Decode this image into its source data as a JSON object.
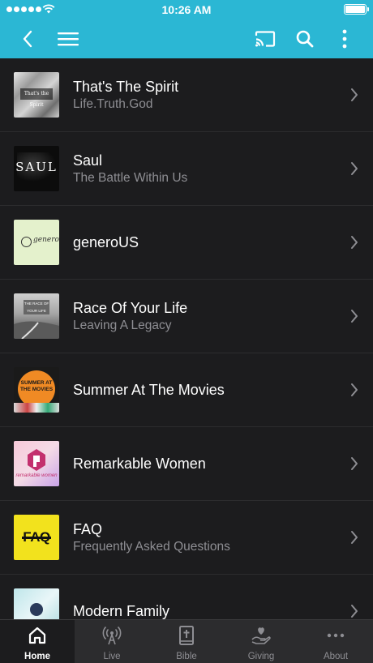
{
  "status_bar": {
    "time": "10:26 AM",
    "signal_icon": "signal-dots-icon",
    "wifi_icon": "wifi-icon",
    "battery_icon": "battery-icon"
  },
  "nav_bar": {
    "background": "#2bb7d4",
    "back_icon": "chevron-left-icon",
    "menu_icon": "hamburger-menu-icon",
    "cast_icon": "cast-icon",
    "search_icon": "search-icon",
    "more_icon": "more-vertical-icon"
  },
  "series": [
    {
      "title": "That's The Spirit",
      "subtitle": "Life.Truth.God",
      "thumb_text": "That's the Spirit",
      "thumb_icon": "mountain-texture-thumbnail"
    },
    {
      "title": "Saul",
      "subtitle": "The Battle Within Us",
      "thumb_text": "SAUL",
      "thumb_icon": "saul-thumbnail"
    },
    {
      "title": "generoUS",
      "subtitle": "",
      "thumb_text": "generoUS",
      "thumb_icon": "generous-thumbnail"
    },
    {
      "title": "Race Of Your Life",
      "subtitle": "Leaving A Legacy",
      "thumb_text": "THE RACE OF YOUR LIFE",
      "thumb_icon": "road-thumbnail"
    },
    {
      "title": "Summer At The Movies",
      "subtitle": "",
      "thumb_text": "SUMMER AT THE MOVIES",
      "thumb_icon": "summer-movies-thumbnail"
    },
    {
      "title": "Remarkable Women",
      "subtitle": "",
      "thumb_text": "remarkable women",
      "thumb_icon": "remarkable-women-thumbnail"
    },
    {
      "title": "FAQ",
      "subtitle": "Frequently Asked Questions",
      "thumb_text": "FAQ",
      "thumb_icon": "faq-thumbnail"
    },
    {
      "title": "Modern Family",
      "subtitle": "",
      "thumb_text": "",
      "thumb_icon": "modern-family-thumbnail"
    }
  ],
  "tabs": [
    {
      "label": "Home",
      "icon": "home-icon",
      "active": true
    },
    {
      "label": "Live",
      "icon": "broadcast-icon",
      "active": false
    },
    {
      "label": "Bible",
      "icon": "bible-icon",
      "active": false
    },
    {
      "label": "Giving",
      "icon": "giving-hand-heart-icon",
      "active": false
    },
    {
      "label": "About",
      "icon": "more-horizontal-icon",
      "active": false
    }
  ]
}
